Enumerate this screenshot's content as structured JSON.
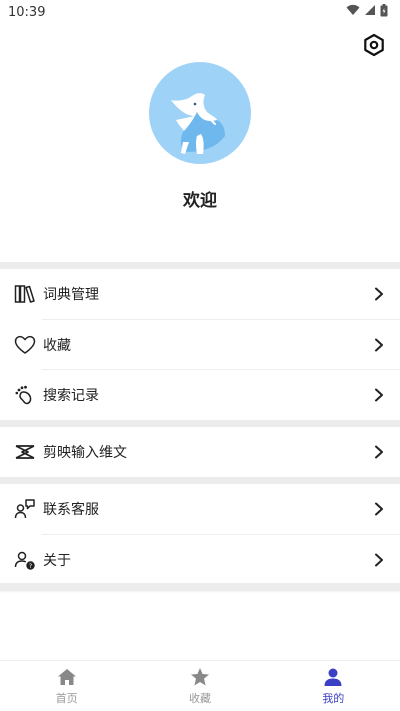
{
  "status_bar": {
    "time": "10:39"
  },
  "profile": {
    "welcome": "欢迎"
  },
  "menu": {
    "groups": [
      [
        {
          "label": "词典管理",
          "icon": "books-icon"
        },
        {
          "label": "收藏",
          "icon": "heart-icon"
        },
        {
          "label": "搜索记录",
          "icon": "footprint-icon"
        }
      ],
      [
        {
          "label": "剪映输入维文",
          "icon": "capcut-icon"
        }
      ],
      [
        {
          "label": "联系客服",
          "icon": "customer-service-icon"
        },
        {
          "label": "关于",
          "icon": "about-icon"
        }
      ]
    ]
  },
  "bottom_nav": {
    "items": [
      {
        "label": "首页",
        "icon": "home-icon",
        "active": false
      },
      {
        "label": "收藏",
        "icon": "star-icon",
        "active": false
      },
      {
        "label": "我的",
        "icon": "person-icon",
        "active": true
      }
    ]
  },
  "colors": {
    "accent": "#3b3fc5",
    "inactive": "#999999",
    "avatar_bg": "#9fd2f7",
    "divider": "#ececec"
  }
}
